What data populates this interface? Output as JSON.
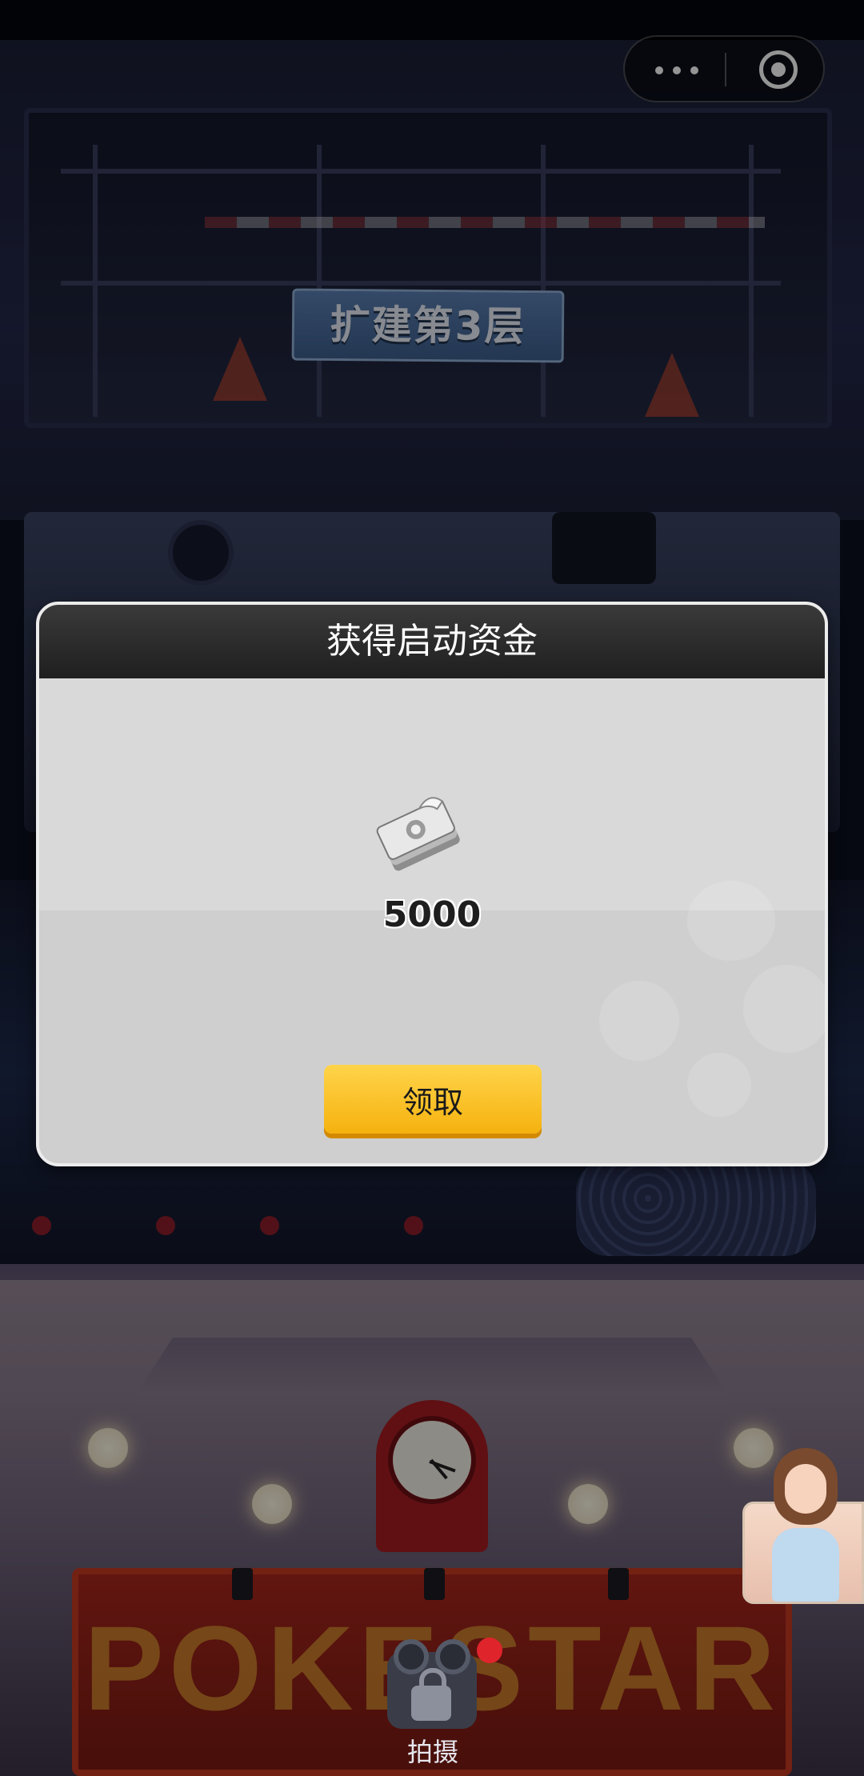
{
  "header": {
    "capsule": {
      "more_icon": "more-dots-icon",
      "close_icon": "target-circle-icon"
    }
  },
  "scene": {
    "expand_sign": "扩建第3层",
    "marquee_text": "POKESTAR"
  },
  "modal": {
    "title": "获得启动资金",
    "reward_icon": "money-bundle-icon",
    "reward_amount": "5000",
    "claim_label": "领取"
  },
  "bottom": {
    "shoot_label": "拍摄",
    "shoot_icon": "film-camera-lock-icon"
  },
  "colors": {
    "modal_header": "#2b2b2b",
    "modal_body": "#d9d9d9",
    "claim_button": "#f7bd1b",
    "badge": "#e0242c"
  }
}
